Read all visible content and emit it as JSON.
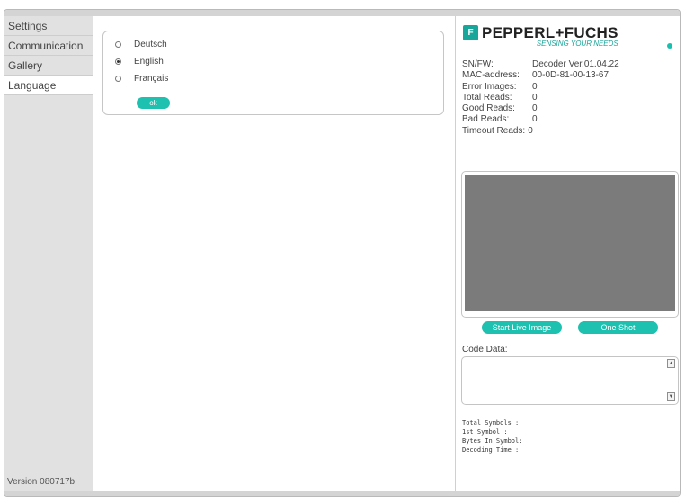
{
  "sidebar": {
    "items": [
      {
        "label": "Settings"
      },
      {
        "label": "Communication"
      },
      {
        "label": "Gallery"
      },
      {
        "label": "Language"
      }
    ],
    "active": "Language",
    "version": "Version 080717b"
  },
  "language": {
    "options": [
      {
        "label": "Deutsch",
        "checked": false
      },
      {
        "label": "English",
        "checked": true
      },
      {
        "label": "Français",
        "checked": false
      }
    ],
    "ok_label": "ok"
  },
  "brand": {
    "logo_mark": "F",
    "name": "PEPPERL+FUCHS",
    "slogan": "SENSING YOUR NEEDS",
    "accent_color": "#1ec0b0"
  },
  "device_info": [
    {
      "label": "SN/FW:",
      "value": "Decoder Ver.01.04.22"
    },
    {
      "label": "MAC-address:",
      "value": "00-0D-81-00-13-67"
    },
    {
      "label": "Error Images:",
      "value": "0"
    },
    {
      "label": "Total Reads:",
      "value": "0"
    },
    {
      "label": "Good Reads:",
      "value": "0"
    },
    {
      "label": "Bad Reads:",
      "value": "0"
    },
    {
      "label": "Timeout Reads:",
      "value": "0"
    }
  ],
  "buttons": {
    "live": "Start Live Image",
    "shot": "One Shot"
  },
  "code": {
    "label": "Code Data:",
    "value": ""
  },
  "stats": [
    {
      "label": "Total Symbols :"
    },
    {
      "label": "1st Symbol :"
    },
    {
      "label": "Bytes In Symbol:"
    },
    {
      "label": "Decoding Time :"
    }
  ]
}
